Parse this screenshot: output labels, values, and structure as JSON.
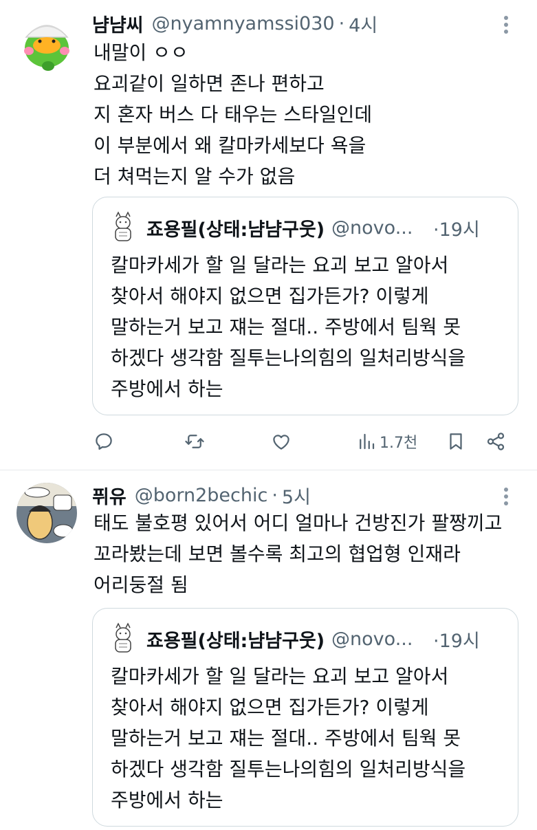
{
  "tweets": [
    {
      "name": "냠냠씨",
      "handle": "@nyamnyamssi030",
      "dot": "·",
      "time": "4시",
      "text": "내말이 ㅇㅇ\n요괴같이 일하면 존나 편하고\n지 혼자 버스 다 태우는 스타일인데\n이 부분에서 왜 칼마카세보다 욕을\n더 쳐먹는지 알 수가 없음",
      "quote": {
        "name": "죠용필(상태:냠냠구웃)",
        "handle": "@novo...",
        "time": "·19시",
        "text": "칼마카세가 할 일 달라는 요괴 보고 알아서\n찾아서 해야지 없으면 집가든가? 이렇게\n말하는거 보고 쟤는 절대.. 주방에서 팀웍 못\n하겠다 생각함 질투는나의힘의 일처리방식을\n주방에서 하는"
      },
      "actions": {
        "views": "1.7천"
      }
    },
    {
      "name": "퓌유",
      "handle": "@born2bechic",
      "dot": "·",
      "time": "5시",
      "text": "태도 불호평 있어서 어디 얼마나 건방진가 팔짱끼고\n꼬라봤는데 보면 볼수록 최고의 협업형 인재라\n어리둥절 됨",
      "quote": {
        "name": "죠용필(상태:냠냠구웃)",
        "handle": "@novo...",
        "time": "·19시",
        "text": "칼마카세가 할 일 달라는 요괴 보고 알아서\n찾아서 해야지 없으면 집가든가? 이렇게\n말하는거 보고 쟤는 절대.. 주방에서 팀웍 못\n하겠다 생각함 질투는나의힘의 일처리방식을\n주방에서 하는"
      }
    }
  ],
  "colors": {
    "text": "#0f1419",
    "secondary": "#536471",
    "border": "#cfd9de",
    "divider": "#e6e9ec"
  }
}
